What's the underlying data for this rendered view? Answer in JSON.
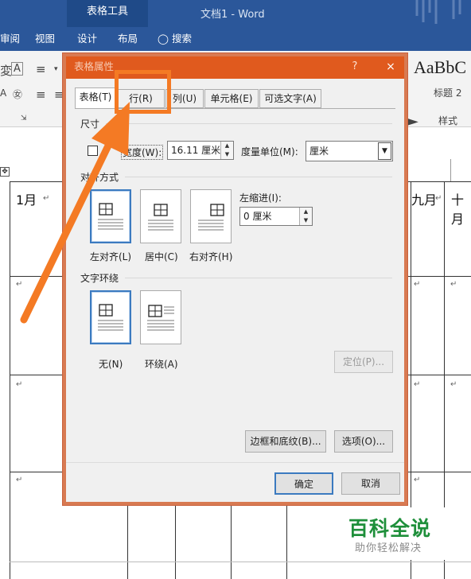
{
  "ribbon": {
    "context_group": "表格工具",
    "doc_title": "文档1 - Word",
    "tabs": [
      "审阅",
      "视图",
      "设计",
      "布局"
    ],
    "search_label": "搜索",
    "style_sample": "AaBbC",
    "style_name": "标题 2",
    "styles_group_label": "样式"
  },
  "document": {
    "cells": [
      "1月",
      "九月",
      "十月"
    ]
  },
  "dialog": {
    "title": "表格属性",
    "help": "?",
    "close": "×",
    "tabs": [
      {
        "label": "表格(T)",
        "selected": true
      },
      {
        "label": "行(R)",
        "selected": false
      },
      {
        "label": "列(U)",
        "selected": false
      },
      {
        "label": "单元格(E)",
        "selected": false
      },
      {
        "label": "可选文字(A)",
        "selected": false
      }
    ],
    "size": {
      "section": "尺寸",
      "width_label": "宽度(W):",
      "width_checked": false,
      "width_value": "16.11 厘米",
      "unit_label": "度量单位(M):",
      "unit_value": "厘米"
    },
    "alignment": {
      "section": "对齐方式",
      "options": [
        "左对齐(L)",
        "居中(C)",
        "右对齐(H)"
      ],
      "selected": "左对齐(L)",
      "indent_label": "左缩进(I):",
      "indent_value": "0 厘米"
    },
    "wrapping": {
      "section": "文字环绕",
      "options": [
        "无(N)",
        "环绕(A)"
      ],
      "selected": "无(N)",
      "position_button": "定位(P)..."
    },
    "borders_button": "边框和底纹(B)...",
    "options_button": "选项(O)...",
    "ok_button": "确定",
    "cancel_button": "取消"
  },
  "watermark": {
    "title": "百科全说",
    "subtitle": "助你轻松解决"
  },
  "colors": {
    "ribbon_blue": "#2b579a",
    "dialog_title_orange": "#e05a1e",
    "annotation_orange": "#f47a24",
    "watermark_green": "#1e8f3a"
  }
}
